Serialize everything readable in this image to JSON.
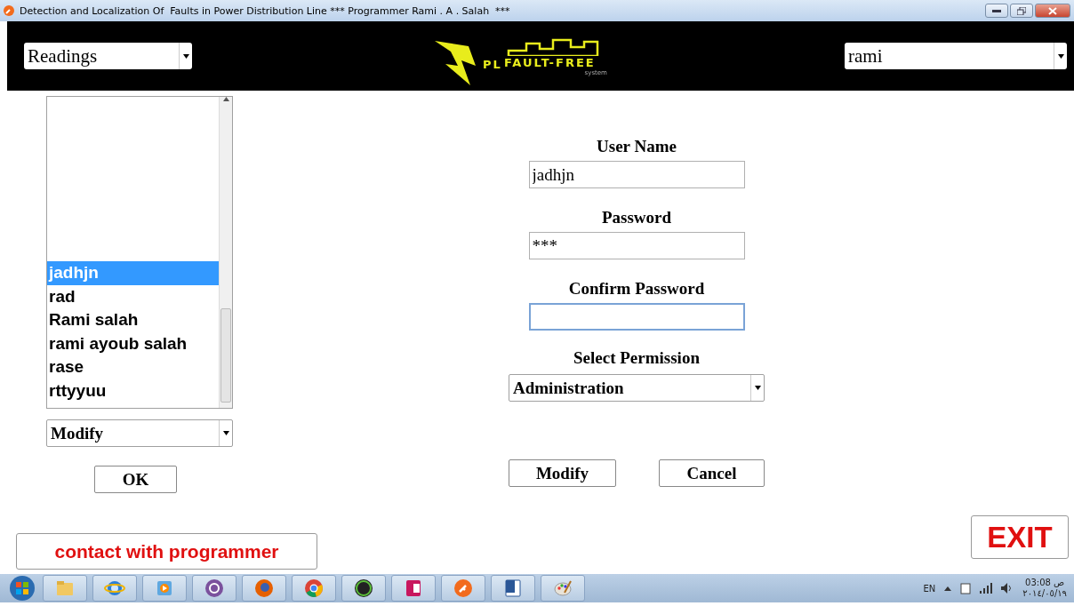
{
  "window": {
    "title": "Detection and Localization Of  Faults in Power Distribution Line *** Programmer Rami . A . Salah  ***"
  },
  "header": {
    "menu_select": "Readings",
    "logo": {
      "initials": "PL",
      "name": "FAULT-FREE",
      "tagline": "system"
    },
    "user_select": "rami"
  },
  "users_list": {
    "items": [
      {
        "label": "jadhjn",
        "selected": true
      },
      {
        "label": "rad",
        "selected": false
      },
      {
        "label": "Rami salah",
        "selected": false
      },
      {
        "label": "rami ayoub salah",
        "selected": false
      },
      {
        "label": "rase",
        "selected": false
      },
      {
        "label": "rttyyuu",
        "selected": false
      }
    ],
    "action_select": "Modify",
    "ok_button": "OK"
  },
  "form": {
    "fields": [
      {
        "label": "User Name",
        "value": "jadhjn",
        "focused": false
      },
      {
        "label": "Password",
        "value": "***",
        "focused": false
      },
      {
        "label": "Confirm Password",
        "focused": true
      }
    ],
    "permission_label": "Select Permission",
    "permission_select": "Administration",
    "buttons": [
      "Modify",
      "Cancel"
    ]
  },
  "contact_button": "contact with programmer",
  "exit_button": "EXIT",
  "taskbar": {
    "apps": [
      {
        "kind": "folder"
      },
      {
        "kind": "ie"
      },
      {
        "kind": "media"
      },
      {
        "kind": "viber"
      },
      {
        "kind": "firefox"
      },
      {
        "kind": "chrome"
      },
      {
        "kind": "amd"
      },
      {
        "kind": "access"
      },
      {
        "kind": "plug"
      },
      {
        "kind": "word"
      },
      {
        "kind": "paint"
      }
    ],
    "language": "EN",
    "time": "03:08 ص",
    "date": "٢٠١٤/٠٥/١٩"
  }
}
